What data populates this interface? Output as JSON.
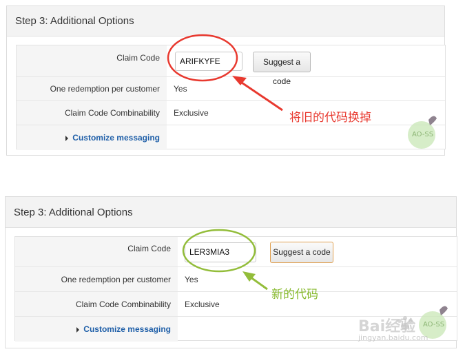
{
  "panel1": {
    "title": "Step 3: Additional Options",
    "claim_code_label": "Claim Code",
    "claim_code_value": "ARIFKYFE",
    "suggest_button": "Suggest a code",
    "one_redemption_label": "One redemption per customer",
    "one_redemption_value": "Yes",
    "combinability_label": "Claim Code Combinability",
    "combinability_value": "Exclusive",
    "customize_link": "Customize messaging",
    "annotation": "将旧的代码换掉",
    "annotation_color": "#e8392f"
  },
  "panel2": {
    "title": "Step 3: Additional Options",
    "claim_code_label": "Claim Code",
    "claim_code_value": "LER3MIA3",
    "suggest_button": "Suggest a code",
    "one_redemption_label": "One redemption per customer",
    "one_redemption_value": "Yes",
    "combinability_label": "Claim Code Combinability",
    "combinability_value": "Exclusive",
    "customize_link": "Customize messaging",
    "annotation": "新的代码",
    "annotation_color": "#86b92c"
  },
  "watermark": {
    "badge_text": "AO-SS",
    "baidu_text": "Bai经验",
    "url": "jingyan.baidu.com"
  }
}
